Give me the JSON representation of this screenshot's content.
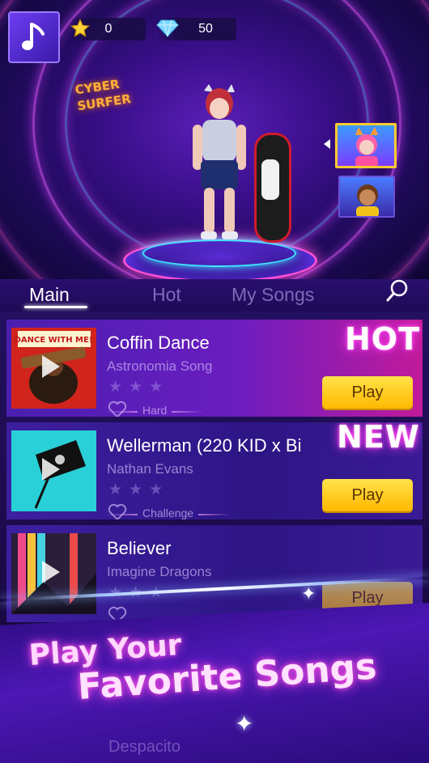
{
  "header": {
    "stars_count": "0",
    "gems_count": "50"
  },
  "hero": {
    "sign_line1": "CYBER",
    "sign_line2": "SURFER"
  },
  "tabs": [
    {
      "label": "Main",
      "active": true
    },
    {
      "label": "Hot",
      "active": false
    },
    {
      "label": "My Songs",
      "active": false
    }
  ],
  "songs": [
    {
      "title": "Coffin Dance",
      "artist": "Astronomia Song",
      "difficulty": "Hard",
      "badge": "HOT",
      "play_label": "Play",
      "thumb_text": "DANCE WITH ME!"
    },
    {
      "title": "Wellerman (220 KID x Bi",
      "artist": "Nathan Evans",
      "difficulty": "Challenge",
      "badge": "NEW",
      "play_label": "Play"
    },
    {
      "title": "Believer",
      "artist": "Imagine Dragons",
      "difficulty": "",
      "badge": "",
      "play_label": "Play"
    }
  ],
  "hidden_row_title": "Despacito",
  "banner": {
    "line1": "Play Your",
    "line2": "Favorite Songs"
  },
  "colors": {
    "accent": "#ff4fe8",
    "play_button": "#ffcc1a",
    "background": "#1a0a4a"
  }
}
